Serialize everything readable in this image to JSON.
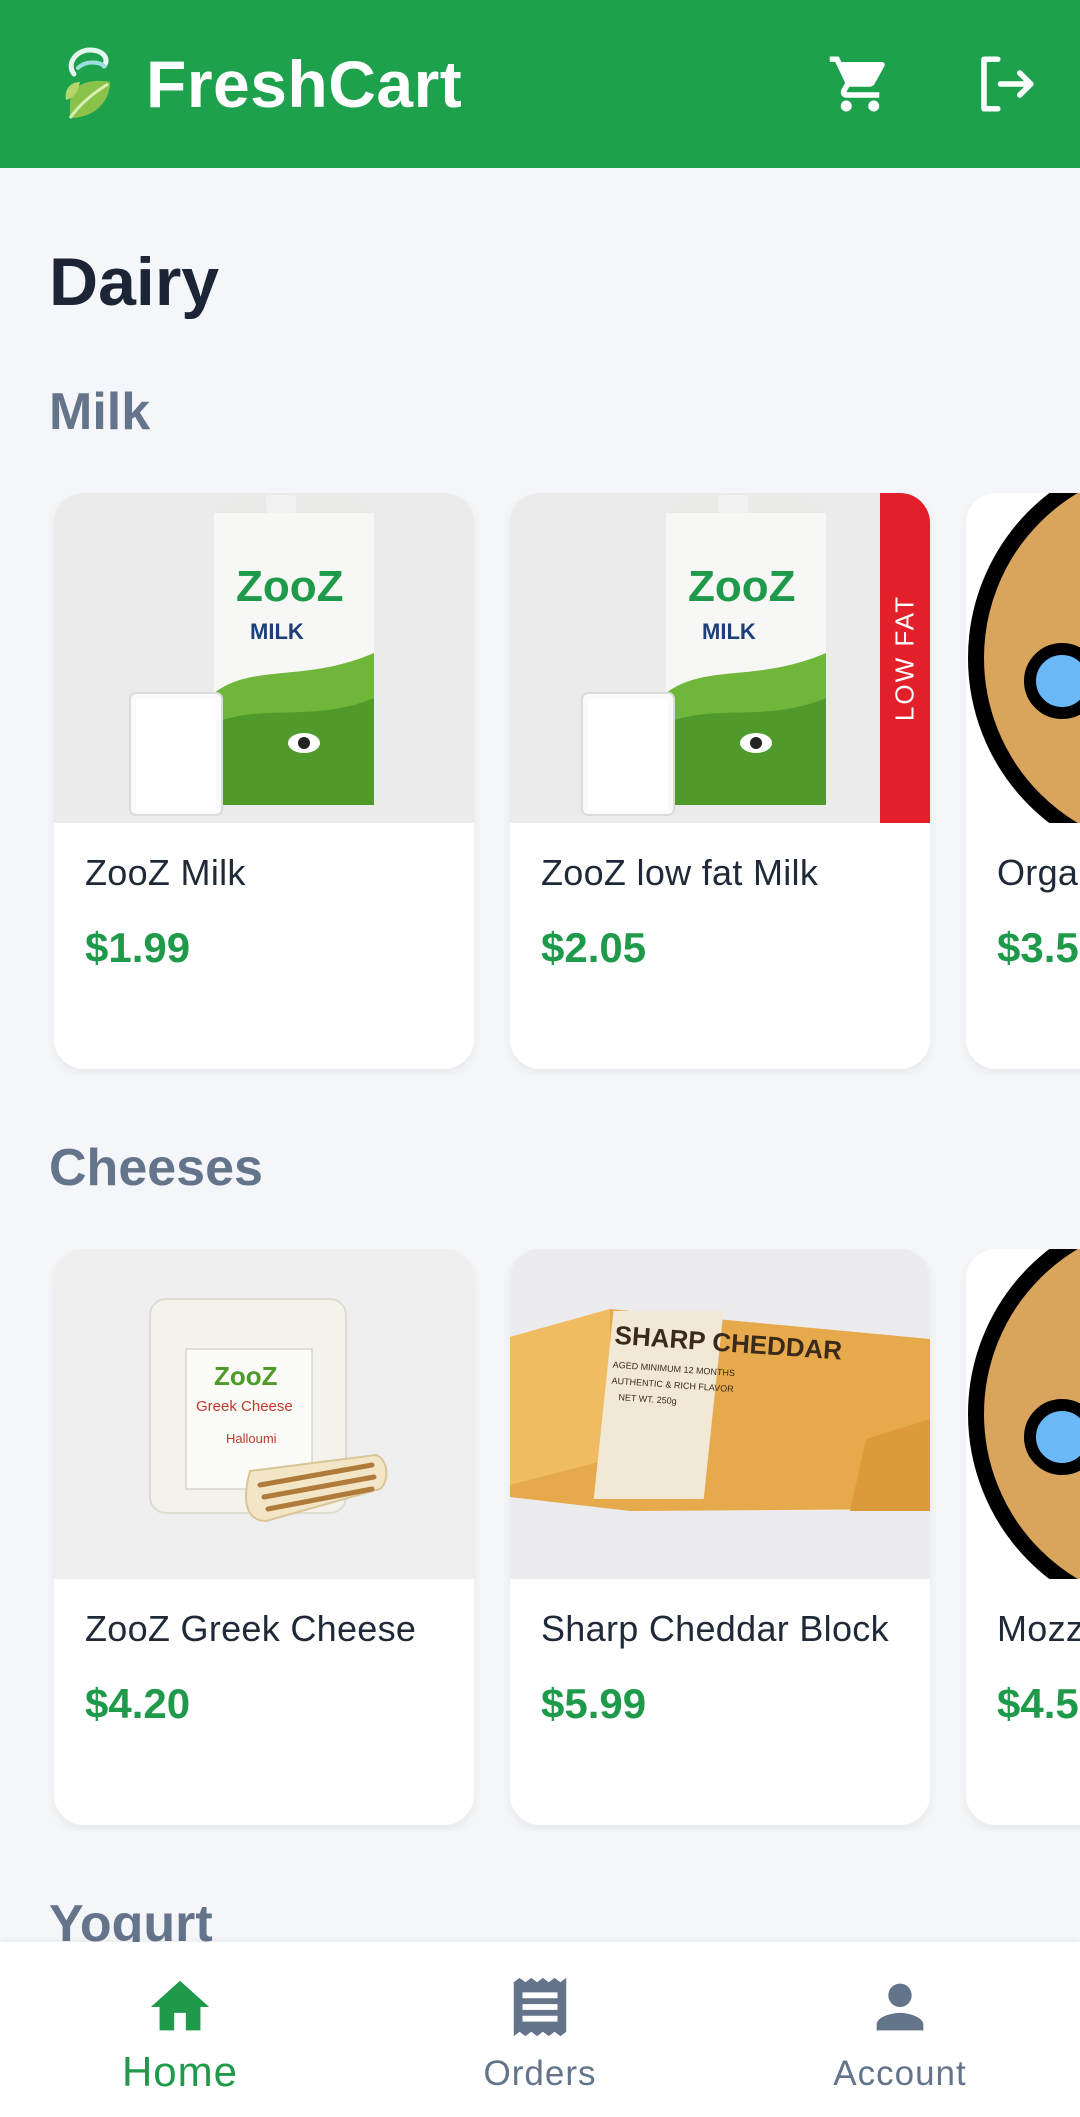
{
  "app": {
    "title": "FreshCart",
    "colors": {
      "primary": "#1ea14d",
      "price": "#1e9a4a",
      "badge": "#e3202a",
      "muted": "#64748b"
    }
  },
  "header_icons": [
    "cart-icon",
    "logout-icon"
  ],
  "page": {
    "title": "Dairy"
  },
  "sections": [
    {
      "title": "Milk",
      "products": [
        {
          "name": "ZooZ Milk",
          "price": "$1.99",
          "brand": "ZooZ",
          "pack_label": "MILK"
        },
        {
          "name": "ZooZ low fat Milk",
          "price": "$2.05",
          "brand": "ZooZ",
          "pack_label": "MILK",
          "badge": "LOW FAT"
        },
        {
          "name": "Organ",
          "price": "$3.5"
        }
      ]
    },
    {
      "title": "Cheeses",
      "products": [
        {
          "name": "ZooZ Greek Cheese",
          "price": "$4.20",
          "brand": "ZooZ",
          "pack_label": "Greek Cheese",
          "pack_sub": "Halloumi"
        },
        {
          "name": "Sharp Cheddar Block",
          "price": "$5.99",
          "pack_label": "SHARP CHEDDAR",
          "pack_sub": "AGED MINIMUM 12 MONTHS",
          "pack_sub2": "AUTHENTIC & RICH FLAVOR",
          "pack_sub3": "NET WT. 250g"
        },
        {
          "name": "Mozz",
          "price": "$4.5"
        }
      ]
    },
    {
      "title": "Yogurt"
    }
  ],
  "bottom_nav": [
    {
      "label": "Home",
      "icon": "home-icon",
      "active": true
    },
    {
      "label": "Orders",
      "icon": "receipt-icon",
      "active": false
    },
    {
      "label": "Account",
      "icon": "person-icon",
      "active": false
    }
  ]
}
